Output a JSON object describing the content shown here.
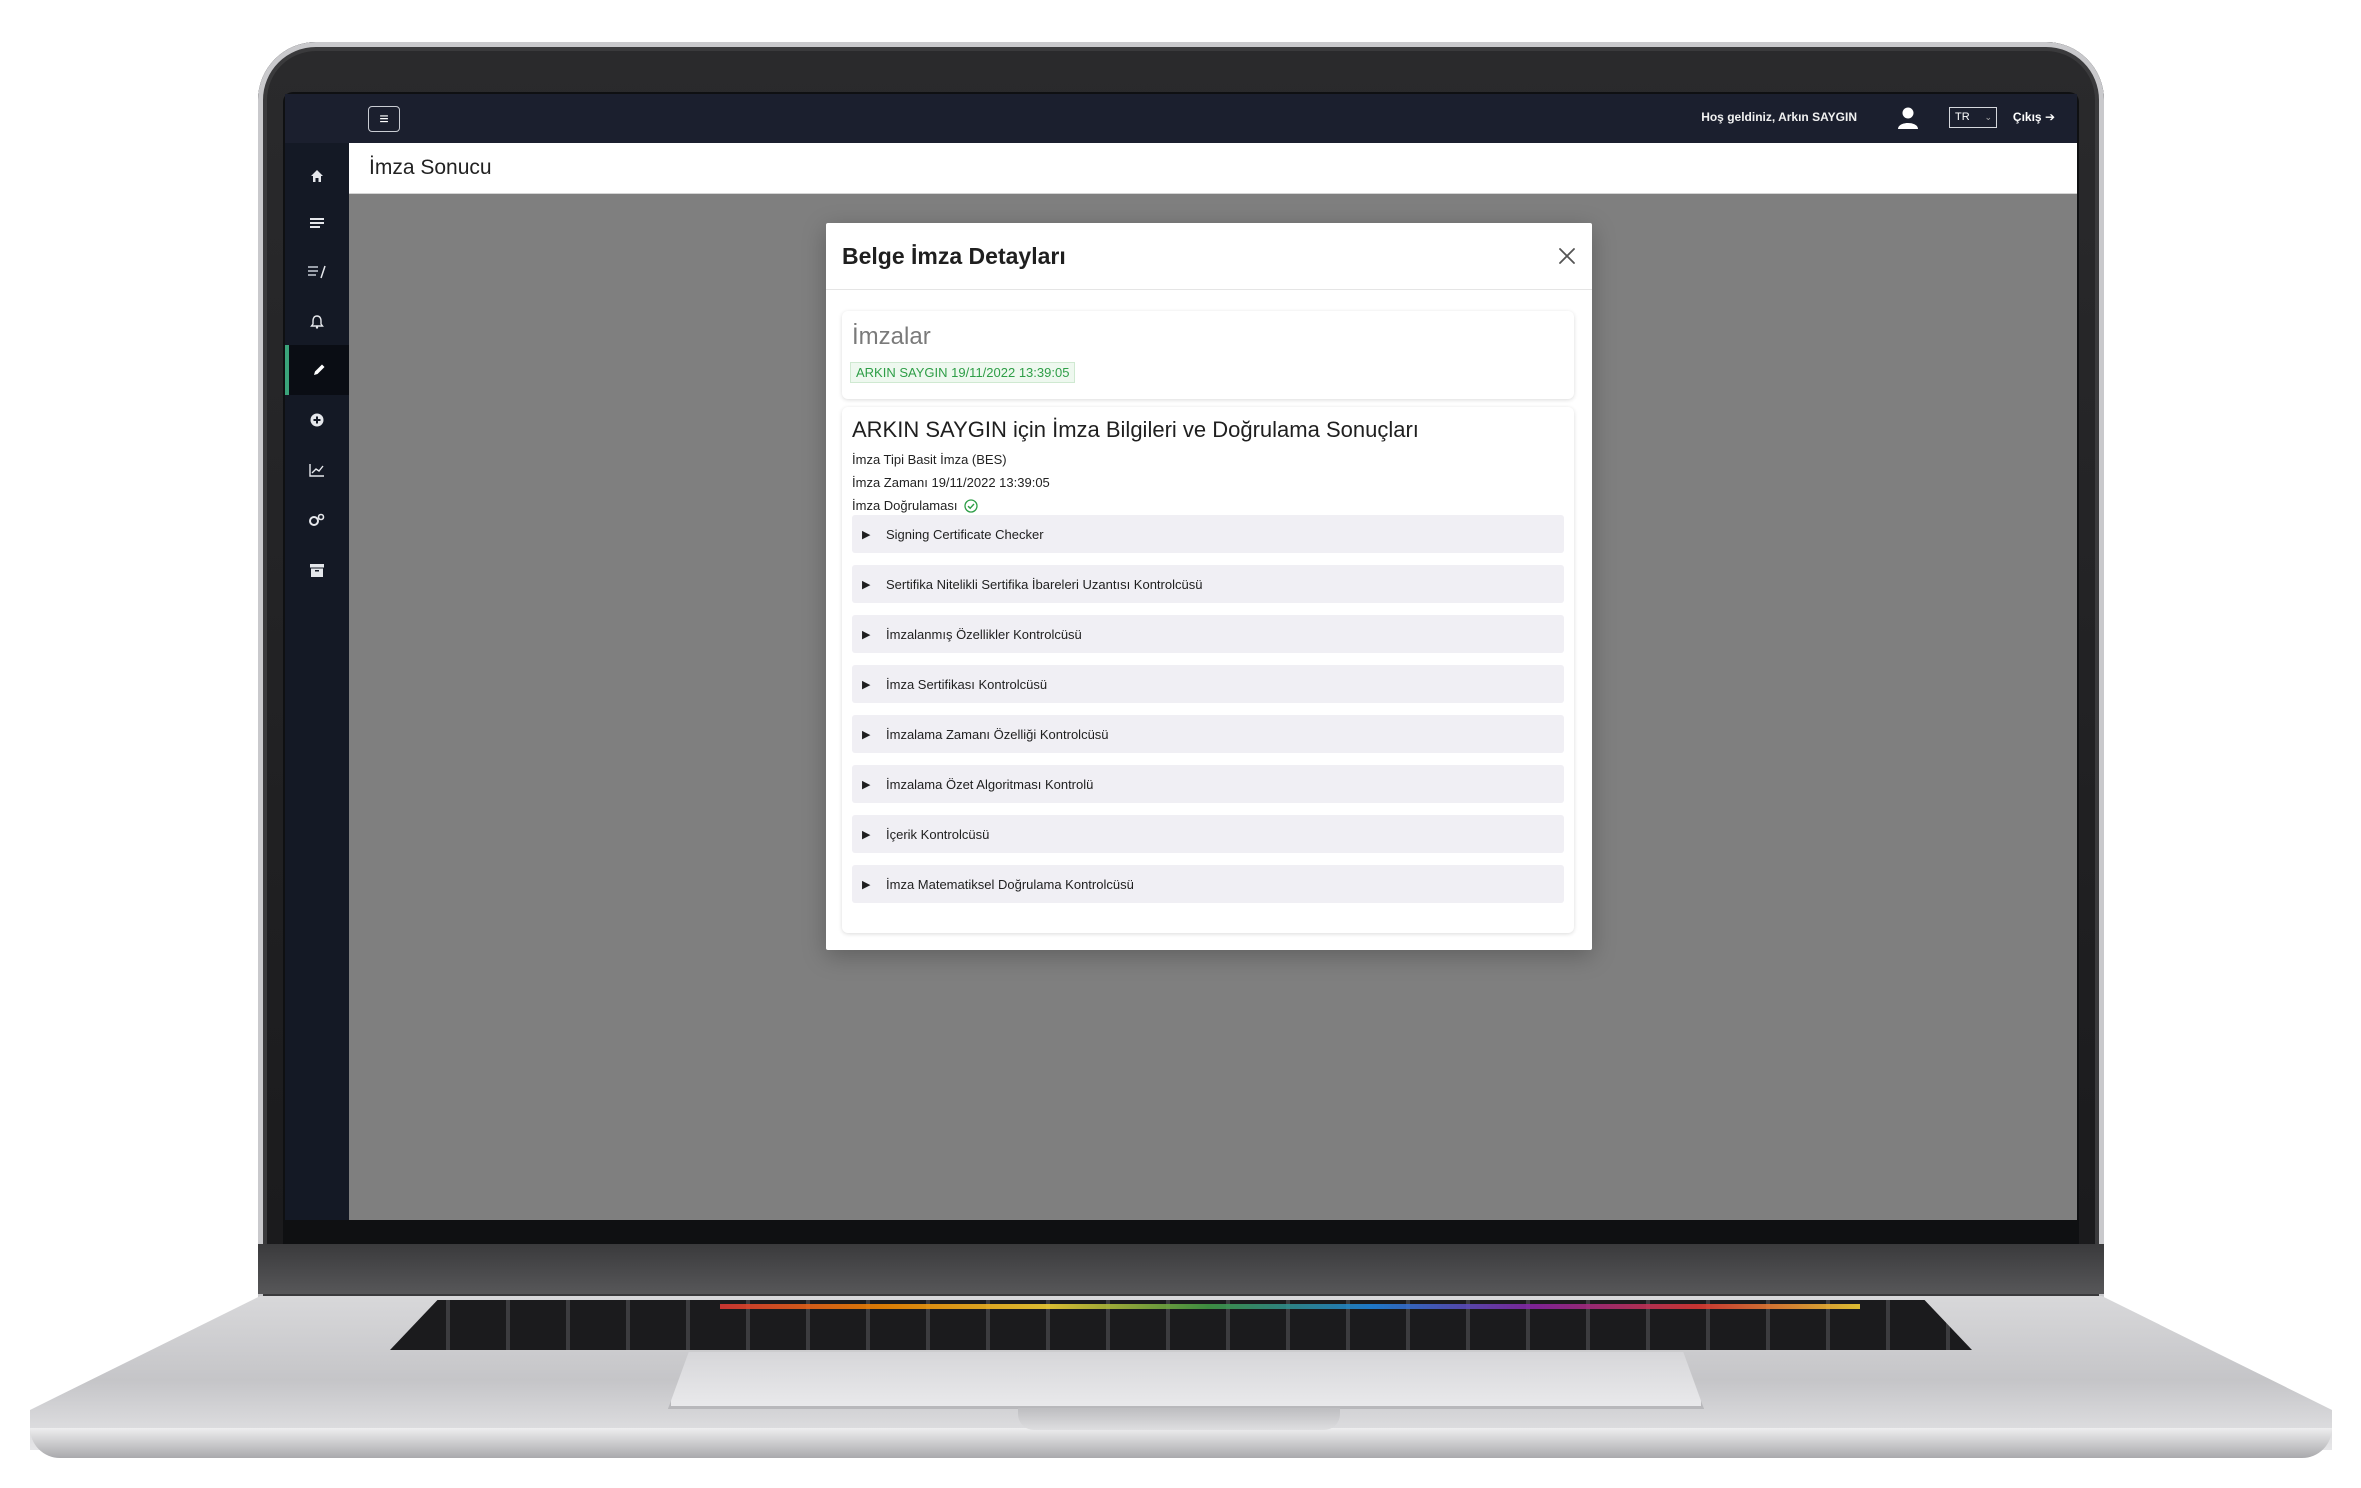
{
  "topbar": {
    "menu_icon": "hamburger-icon",
    "welcome": "Hoş geldiniz, Arkın SAYGIN",
    "user_icon": "user-icon",
    "language": "TR",
    "logout_label": "Çıkış ➔"
  },
  "sidebar": {
    "items": [
      {
        "icon": "home-icon",
        "glyph": "⌂"
      },
      {
        "icon": "list-icon",
        "glyph": "≣"
      },
      {
        "icon": "document-edit-icon",
        "glyph": "▤/"
      },
      {
        "icon": "bell-icon",
        "glyph": "🔔"
      },
      {
        "icon": "pen-icon",
        "glyph": "✎",
        "active": true
      },
      {
        "icon": "plus-circle-icon",
        "glyph": "⊕"
      },
      {
        "icon": "chart-line-icon",
        "glyph": "📈"
      },
      {
        "icon": "cogs-icon",
        "glyph": "⚙"
      },
      {
        "icon": "archive-icon",
        "glyph": "▣"
      }
    ]
  },
  "page": {
    "title": "İmza Sonucu"
  },
  "modal": {
    "title": "Belge İmza Detayları",
    "close_icon": "close-icon",
    "signatures": {
      "heading": "İmzalar",
      "badge": "ARKIN SAYGIN 19/11/2022 13:39:05"
    },
    "details": {
      "heading": "ARKIN SAYGIN için İmza Bilgileri ve Doğrulama Sonuçları",
      "signature_type": "İmza Tipi Basit İmza (BES)",
      "signature_time": "İmza Zamanı 19/11/2022  13:39:05",
      "verification_label": "İmza Doğrulaması",
      "verification_icon": "check-circle-icon",
      "checkers": [
        "Signing Certificate Checker",
        "Sertifika Nitelikli Sertifika İbareleri Uzantısı Kontrolcüsü",
        "İmzalanmış Özellikler Kontrolcüsü",
        "İmza Sertifikası Kontrolcüsü",
        "İmzalama Zamanı Özelliği Kontrolcüsü",
        "İmzalama Özet Algoritması Kontrolü",
        "İçerik Kontrolcüsü",
        "İmza Matematiksel Doğrulama Kontrolcüsü"
      ]
    }
  },
  "colors": {
    "topbar": "#1b1f2e",
    "sidebar": "#141925",
    "active_accent": "#3aa37a",
    "backdrop": "#7f7f7f",
    "badge_green": "#2e9e47"
  }
}
